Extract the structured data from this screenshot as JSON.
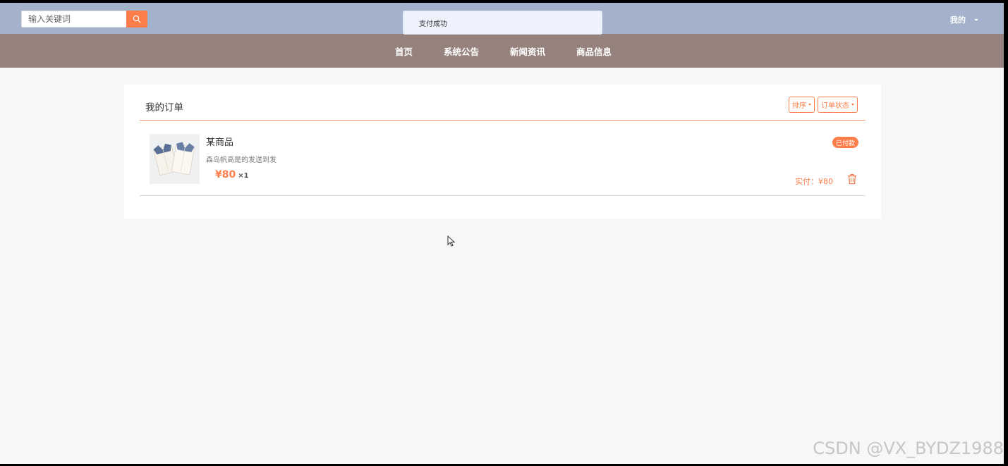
{
  "header": {
    "search": {
      "placeholder": "输入关键词",
      "value": ""
    },
    "user_menu": {
      "label": "我的"
    },
    "toast": {
      "message": "支付成功"
    }
  },
  "nav": {
    "items": [
      {
        "label": "首页"
      },
      {
        "label": "系统公告"
      },
      {
        "label": "新闻资讯"
      },
      {
        "label": "商品信息"
      }
    ]
  },
  "orders": {
    "title": "我的订单",
    "sort_label": "排序",
    "status_filter_label": "订单状态",
    "items": [
      {
        "name": "某商品",
        "description": "森岛帆高是的发送到发",
        "price": "¥80",
        "quantity": "×1",
        "status": "已付款",
        "paid_label": "实付：",
        "paid_amount": "¥80"
      }
    ]
  },
  "watermark": "CSDN @VX_BYDZ1988",
  "colors": {
    "topbar": "#a3b1cb",
    "navbar": "#96827d",
    "accent": "#fd7e4a",
    "page_bg": "#f7f7f7"
  },
  "icons": [
    "search-icon",
    "chevron-down-icon",
    "trash-icon",
    "cursor-icon"
  ]
}
